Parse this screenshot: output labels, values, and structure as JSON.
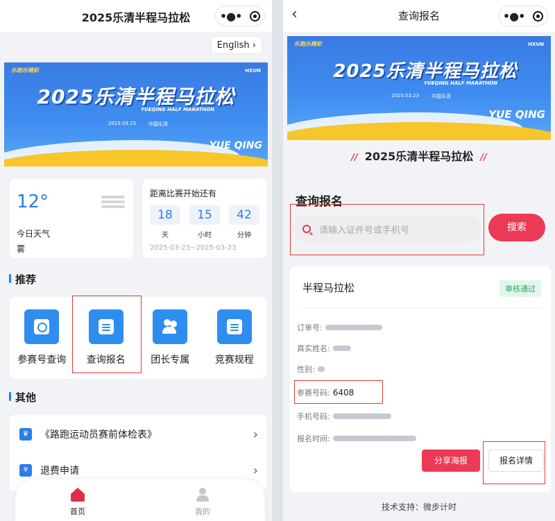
{
  "home": {
    "title": "2025乐清半程马拉松",
    "lang_button": "English",
    "banner": {
      "title": "2025乐清半程马拉松",
      "subtitle": "YUEQING HALF MARATHON",
      "date": "2025.03.23",
      "place": "中国乐清",
      "logo": "乐跑乐精彩",
      "sponsor": "HXUN",
      "city": "YUE QING"
    },
    "weather": {
      "temp": "12°",
      "label": "今日天气",
      "value": "雾"
    },
    "countdown": {
      "heading": "距离比赛开始还有",
      "days": "18",
      "days_unit": "天",
      "hours": "15",
      "hours_unit": "小时",
      "minutes": "42",
      "minutes_unit": "分钟",
      "range": "2025-03-23~2025-03-23"
    },
    "recommend": {
      "title": "推荐",
      "items": [
        {
          "label": "参赛号查询",
          "icon": "search-icon"
        },
        {
          "label": "查询报名",
          "icon": "document-search-icon"
        },
        {
          "label": "团长专属",
          "icon": "team-icon"
        },
        {
          "label": "竞赛规程",
          "icon": "rules-icon"
        }
      ]
    },
    "other": {
      "title": "其他",
      "items": [
        {
          "label": "《路跑运动员赛前体检表》",
          "icon": "trophy-icon"
        },
        {
          "label": "退费申请",
          "icon": "refund-icon"
        }
      ]
    },
    "tabs": [
      {
        "label": "首页",
        "icon": "home-icon"
      },
      {
        "label": "我的",
        "icon": "user-icon"
      }
    ]
  },
  "query": {
    "title": "查询报名",
    "event_title": "2025乐清半程马拉松",
    "section_title": "查询报名",
    "search_placeholder": "请输入证件号或手机号",
    "search_button": "搜索",
    "result": {
      "race": "半程马拉松",
      "status": "审核通过",
      "order_label": "订单号:",
      "name_label": "真实姓名:",
      "gender_label": "性别:",
      "bib_label": "参赛号码:",
      "bib_value": "6408",
      "phone_label": "手机号码:",
      "time_label": "报名时间:",
      "share_button": "分享海报",
      "detail_button": "报名详情"
    },
    "tech_support": "技术支持：微步计时"
  },
  "colors": {
    "accent_blue": "#2b7de9",
    "accent_red": "#eb3a56",
    "highlight": "#e2382f",
    "status_green": "#2aa866"
  }
}
